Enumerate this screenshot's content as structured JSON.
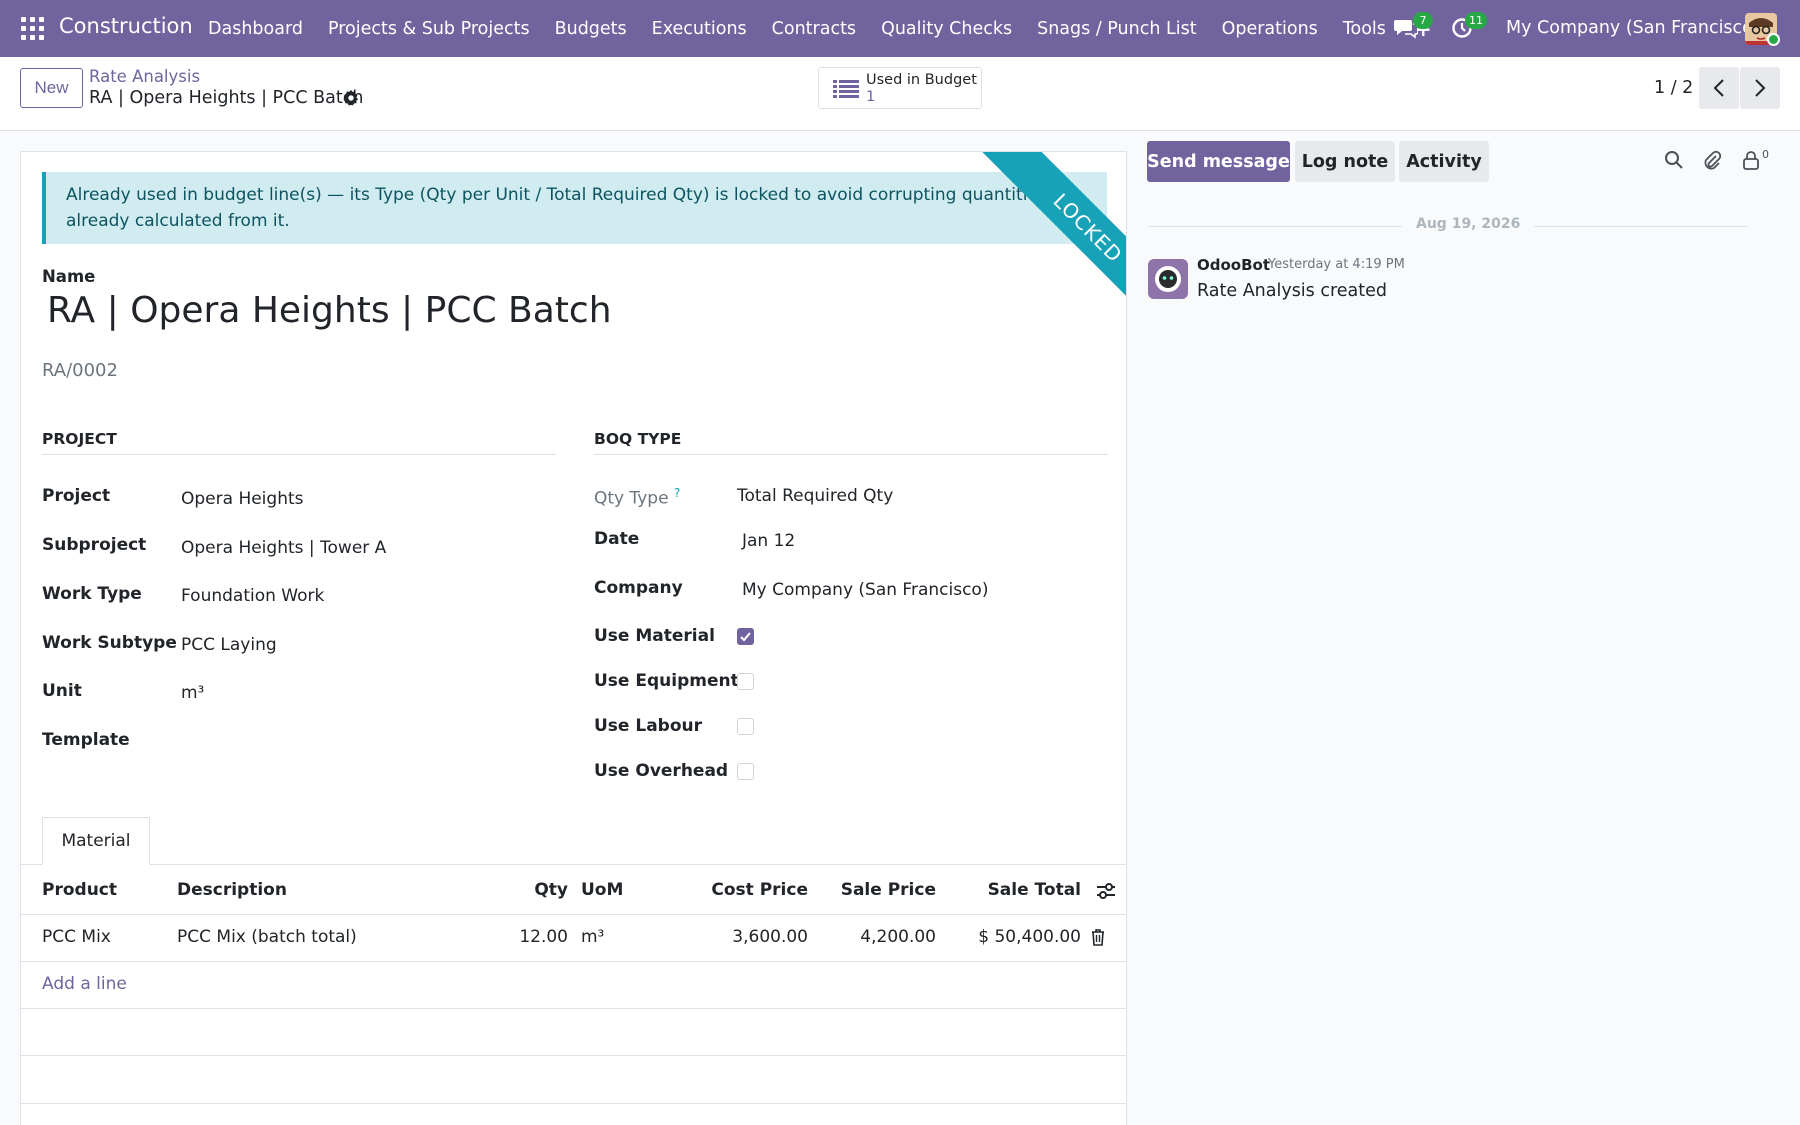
{
  "navbar": {
    "app_title": "Construction",
    "menu": [
      "Dashboard",
      "Projects & Sub Projects",
      "Budgets",
      "Executions",
      "Contracts",
      "Quality Checks",
      "Snags / Punch List",
      "Operations",
      "Tools"
    ],
    "plus": "+",
    "messages_count": "7",
    "activities_count": "11",
    "company": "My Company (San Francisco)"
  },
  "control": {
    "new_label": "New",
    "breadcrumb_parent": "Rate Analysis",
    "breadcrumb_current": "RA | Opera Heights | PCC Batch",
    "smart_button": {
      "label": "Used in Budget",
      "value": "1"
    },
    "pager": "1 / 2"
  },
  "form": {
    "alert": "Already used in budget line(s) — its Type (Qty per Unit / Total Required Qty) is locked to avoid corrupting quantities already calculated from it.",
    "ribbon": "LOCKED",
    "name_label": "Name",
    "name": "RA | Opera Heights | PCC Batch",
    "reference": "RA/0002",
    "project_group": {
      "title": "PROJECT",
      "fields": [
        {
          "label": "Project",
          "value": "Opera Heights"
        },
        {
          "label": "Subproject",
          "value": "Opera Heights | Tower A"
        },
        {
          "label": "Work Type",
          "value": "Foundation Work"
        },
        {
          "label": "Work Subtype",
          "value": "PCC Laying"
        },
        {
          "label": "Unit",
          "value": "m³"
        },
        {
          "label": "Template",
          "value": ""
        }
      ]
    },
    "boq_group": {
      "title": "BOQ TYPE",
      "qty_type_label": "Qty Type",
      "qty_type_help": "?",
      "qty_type": "Total Required Qty",
      "date_label": "Date",
      "date": "Jan 12",
      "company_label": "Company",
      "company": "My Company (San Francisco)",
      "checkboxes": [
        {
          "label": "Use Material",
          "checked": true
        },
        {
          "label": "Use Equipment",
          "checked": false
        },
        {
          "label": "Use Labour",
          "checked": false
        },
        {
          "label": "Use Overhead",
          "checked": false
        }
      ]
    },
    "tab": "Material",
    "table": {
      "headers": [
        "Product",
        "Description",
        "Qty",
        "UoM",
        "Cost Price",
        "Sale Price",
        "Sale Total"
      ],
      "rows": [
        [
          "PCC Mix",
          "PCC Mix (batch total)",
          "12.00",
          "m³",
          "3,600.00",
          "4,200.00",
          "$ 50,400.00"
        ]
      ],
      "add_line": "Add a line"
    }
  },
  "chatter": {
    "send_message": "Send message",
    "log_note": "Log note",
    "activity": "Activity",
    "followers_count": "0",
    "date_separator": "Aug 19, 2026",
    "message": {
      "author": "OdooBot",
      "time": "Yesterday at 4:19 PM",
      "body": "Rate Analysis created"
    }
  }
}
